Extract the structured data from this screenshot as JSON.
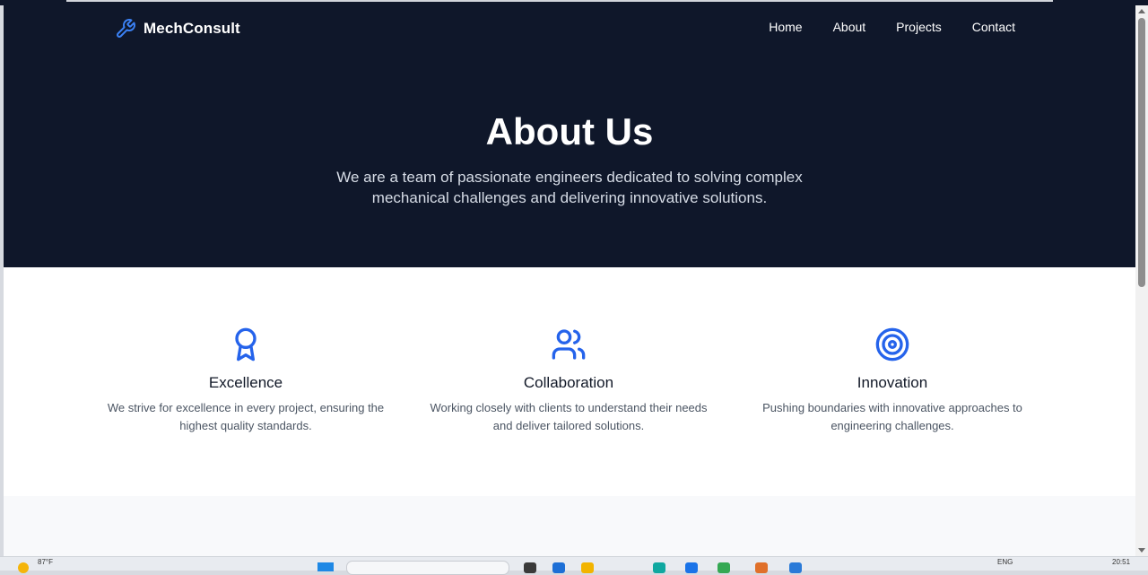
{
  "site": {
    "brand": "MechConsult",
    "nav": [
      "Home",
      "About",
      "Projects",
      "Contact"
    ]
  },
  "hero": {
    "title": "About Us",
    "subtitle": "We are a team of passionate engineers dedicated to solving complex mechanical challenges and delivering innovative solutions."
  },
  "values": [
    {
      "icon": "award-icon",
      "title": "Excellence",
      "text": "We strive for excellence in every project, ensuring the highest quality standards."
    },
    {
      "icon": "users-icon",
      "title": "Collaboration",
      "text": "Working closely with clients to understand their needs and deliver tailored solutions."
    },
    {
      "icon": "target-icon",
      "title": "Innovation",
      "text": "Pushing boundaries with innovative approaches to engineering challenges."
    }
  ],
  "taskbar": {
    "temperature": "87°F",
    "language": "ENG",
    "time": "20:51"
  },
  "colors": {
    "hero_bg": "#0f172a",
    "accent": "#2563eb",
    "section_alt_bg": "#f8f9fb"
  }
}
